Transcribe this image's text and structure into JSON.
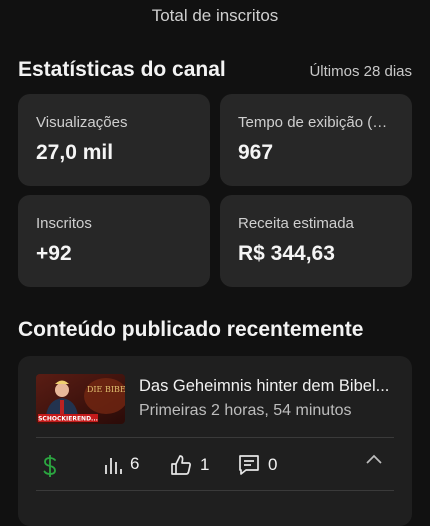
{
  "header": {
    "total_label": "Total de inscritos"
  },
  "stats_section": {
    "title": "Estatísticas do canal",
    "period": "Últimos 28 dias",
    "cards": [
      {
        "label": "Visualizações",
        "value": "27,0 mil"
      },
      {
        "label": "Tempo de exibição (horas)",
        "value": "967"
      },
      {
        "label": "Inscritos",
        "value": "+92"
      },
      {
        "label": "Receita estimada",
        "value": "R$ 344,63"
      }
    ]
  },
  "recent_section": {
    "title": "Conteúdo publicado recentemente",
    "video": {
      "title": "Das Geheimnis hinter dem Bibel...",
      "meta": "Primeiras 2 horas, 54 minutos",
      "thumbnail_text": "DIE BIBEL",
      "thumbnail_banner": "SCHOCKIEREND...",
      "stats": {
        "revenue_icon": "dollar-icon",
        "views": "6",
        "likes": "1",
        "comments": "0"
      }
    }
  },
  "colors": {
    "background": "#111111",
    "card": "#272727",
    "revenue_green": "#2ba640"
  }
}
